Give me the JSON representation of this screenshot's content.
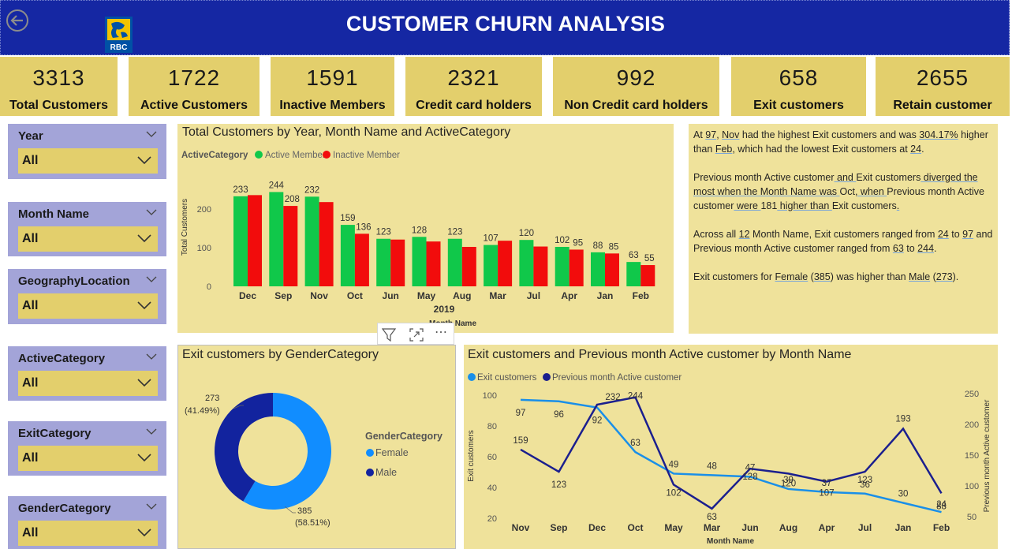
{
  "header": {
    "title": "CUSTOMER CHURN ANALYSIS",
    "logo_text": "RBC"
  },
  "kpis": [
    {
      "value": "3313",
      "label": "Total Customers"
    },
    {
      "value": "1722",
      "label": "Active Customers"
    },
    {
      "value": "1591",
      "label": "Inactive Members"
    },
    {
      "value": "2321",
      "label": "Credit card holders"
    },
    {
      "value": "992",
      "label": "Non Credit card holders"
    },
    {
      "value": "658",
      "label": "Exit customers"
    },
    {
      "value": "2655",
      "label": "Retain customer"
    }
  ],
  "slicers": [
    {
      "title": "Year",
      "value": "All"
    },
    {
      "title": "Month Name",
      "value": "All"
    },
    {
      "title": "GeographyLocation",
      "value": "All"
    },
    {
      "title": "ActiveCategory",
      "value": "All"
    },
    {
      "title": "ExitCategory",
      "value": "All"
    },
    {
      "title": "GenderCategory",
      "value": "All"
    }
  ],
  "bar_chart": {
    "title": "Total Customers by Year, Month Name and ActiveCategory",
    "legend_title": "ActiveCategory",
    "year_label": "2019",
    "axis_title_partial": "Month Name",
    "colors": {
      "active": "#10c84a",
      "inactive": "#f20c0c"
    }
  },
  "insights": {
    "p1": [
      "At ",
      "97",
      ", ",
      "Nov",
      " had the highest Exit customers and was ",
      "304.17%",
      " higher than ",
      "Feb",
      ", which had the lowest Exit customers at ",
      "24",
      "."
    ],
    "p2": [
      "Previous month Active customer",
      " and ",
      "Exit customers",
      " diverged the most when the Month Name was ",
      "Oct",
      ", when ",
      "Previous month Active customer",
      " were ",
      "181",
      " higher than ",
      "Exit customers",
      "."
    ],
    "p3": [
      "Across all ",
      "12",
      " Month Name, Exit customers ranged from ",
      "24",
      " to ",
      "97",
      " and Previous month Active customer ranged from ",
      "63",
      " to ",
      "244",
      "."
    ],
    "p4": [
      "Exit customers for ",
      "Female",
      " (",
      "385",
      ") was higher than ",
      "Male",
      " (",
      "273",
      ")."
    ]
  },
  "donut": {
    "title": "Exit customers by GenderCategory",
    "legend_title": "GenderCategory",
    "colors": {
      "Female": "#118dff",
      "Male": "#12239e"
    }
  },
  "line_chart": {
    "title": "Exit customers and Previous month Active customer by Month Name",
    "colors": {
      "exit": "#1a8fe8",
      "prev": "#1b1f8e"
    }
  },
  "chart_data": [
    {
      "type": "bar",
      "title": "Total Customers by Year, Month Name and ActiveCategory",
      "xlabel": "Month Name",
      "ylabel": "Total Customers",
      "categories": [
        "Dec",
        "Sep",
        "Nov",
        "Oct",
        "Jun",
        "May",
        "Aug",
        "Mar",
        "Jul",
        "Apr",
        "Jan",
        "Feb"
      ],
      "series": [
        {
          "name": "Active Member",
          "values": [
            233,
            244,
            232,
            159,
            123,
            128,
            123,
            107,
            120,
            102,
            88,
            63
          ]
        },
        {
          "name": "Inactive Member",
          "values": [
            236,
            208,
            218,
            136,
            121,
            116,
            102,
            118,
            103,
            95,
            85,
            55
          ]
        }
      ],
      "value_labels": [
        [
          "233",
          "244",
          "232",
          "159",
          "123",
          "128",
          "123",
          "107",
          "120",
          "102",
          "88",
          "63"
        ],
        [
          "",
          "208",
          "",
          "136",
          "",
          "",
          "",
          "",
          "",
          "95",
          "85",
          "55"
        ]
      ],
      "yticks": [
        0,
        100,
        200
      ],
      "ylim": [
        0,
        260
      ],
      "legend": "top-left"
    },
    {
      "type": "pie",
      "title": "Exit customers by GenderCategory",
      "categories": [
        "Female",
        "Male"
      ],
      "values": [
        385,
        273
      ],
      "percent_labels": [
        "385\n(58.51%)",
        "273\n(41.49%)"
      ],
      "legend": "right"
    },
    {
      "type": "line",
      "title": "Exit customers and Previous month Active customer by Month Name",
      "xlabel": "Month Name",
      "ylabel": "Exit customers",
      "y2label": "Previous month Active customer",
      "categories": [
        "Nov",
        "Sep",
        "Dec",
        "Oct",
        "May",
        "Mar",
        "Jun",
        "Aug",
        "Apr",
        "Jul",
        "Jan",
        "Feb"
      ],
      "series": [
        {
          "name": "Exit customers",
          "values": [
            97,
            96,
            92,
            63,
            49,
            48,
            47,
            39,
            37,
            36,
            30,
            24
          ],
          "axis": "left"
        },
        {
          "name": "Previous month Active customer",
          "values": [
            159,
            123,
            232,
            244,
            102,
            63,
            128,
            120,
            107,
            123,
            193,
            88
          ],
          "axis": "right"
        }
      ],
      "yticks": [
        20,
        40,
        60,
        80,
        100
      ],
      "y2ticks": [
        50,
        100,
        150,
        200,
        250
      ],
      "ylim": [
        20,
        100
      ],
      "y2lim": [
        50,
        250
      ],
      "legend": "top-left"
    }
  ]
}
